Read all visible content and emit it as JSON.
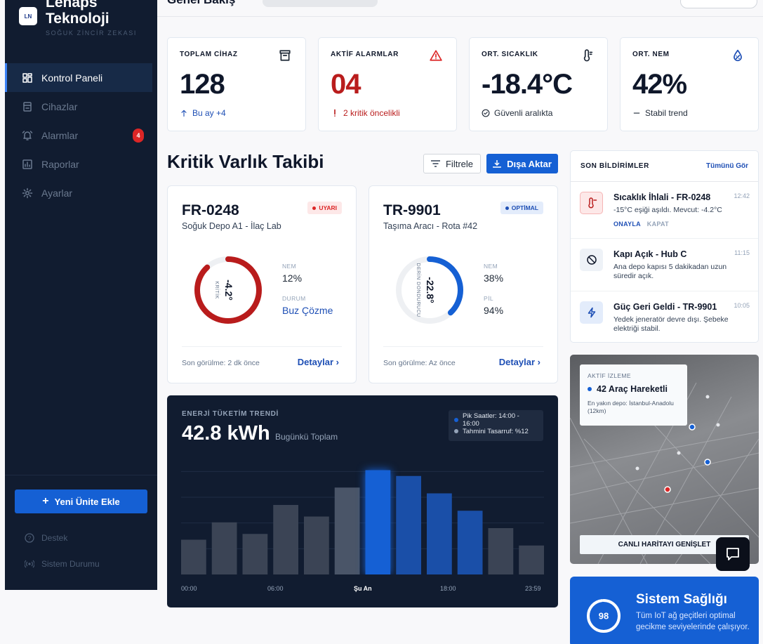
{
  "brand": {
    "name_line1": "Lenaps",
    "name_line2": "Teknoloji",
    "tagline": "SOĞUK ZİNCİR ZEKASI",
    "logo_text": "LN"
  },
  "nav": [
    {
      "label": "Kontrol Paneli",
      "icon": "dashboard-icon",
      "active": true
    },
    {
      "label": "Cihazlar",
      "icon": "devices-icon"
    },
    {
      "label": "Alarmlar",
      "icon": "alarm-icon",
      "badge": "4"
    },
    {
      "label": "Raporlar",
      "icon": "reports-icon"
    },
    {
      "label": "Ayarlar",
      "icon": "settings-icon"
    }
  ],
  "sidebar_actions": {
    "add_unit": "Yeni Ünite Ekle",
    "support": "Destek",
    "system_status": "Sistem Durumu"
  },
  "header": {
    "title": "Genel Bakış"
  },
  "stats": [
    {
      "label": "TOPLAM CİHAZ",
      "value": "128",
      "sub": "Bu ay +4",
      "sub_icon": "arrow-up-icon",
      "icon": "archive-icon",
      "value_color": "#0f172a",
      "sub_color": "#1e4fb5"
    },
    {
      "label": "AKTİF ALARMLAR",
      "value": "04",
      "sub": "2 kritik öncelikli",
      "sub_icon": "exclamation-icon",
      "icon": "warning-icon",
      "value_color": "#b91c1c",
      "sub_color": "#b91c1c"
    },
    {
      "label": "ORT. SICAKLIK",
      "value": "-18.4°C",
      "sub": "Güvenli aralıkta",
      "sub_icon": "check-circle-icon",
      "icon": "thermometer-icon",
      "value_color": "#0f172a",
      "sub_color": "#1f2937"
    },
    {
      "label": "ORT. NEM",
      "value": "42%",
      "sub": "Stabil trend",
      "sub_icon": "dash-icon",
      "icon": "humidity-icon",
      "value_color": "#0f172a",
      "sub_color": "#1f2937"
    }
  ],
  "section": {
    "title": "Kritik Varlık Takibi",
    "filter": "Filtrele",
    "export": "Dışa Aktar"
  },
  "assets": [
    {
      "id": "FR-0248",
      "location": "Soğuk Depo A1 - İlaç Lab",
      "tag": "UYARI",
      "tag_color": "#dc2626",
      "tag_bg": "#fde8e8",
      "gauge_value": "-4.2°",
      "gauge_label": "KRİTİK",
      "gauge_fill": 0.88,
      "gauge_color": "#b91c1c",
      "m1_label": "NEM",
      "m1_value": "12%",
      "m2_label": "DURUM",
      "m2_value": "Buz Çözme",
      "m2_color": "#1e4fb5",
      "last_seen": "Son görülme: 2 dk önce",
      "details": "Detaylar"
    },
    {
      "id": "TR-9901",
      "location": "Taşıma Aracı - Rota #42",
      "tag": "OPTİMAL",
      "tag_color": "#1e4fb5",
      "tag_bg": "#e3ecfb",
      "gauge_value": "-22.8°",
      "gauge_label": "DERİN DONDURUCU",
      "gauge_fill": 0.38,
      "gauge_color": "#1560d4",
      "m1_label": "NEM",
      "m1_value": "38%",
      "m2_label": "PİL",
      "m2_value": "94%",
      "m2_color": "#1f2937",
      "last_seen": "Son görülme: Az önce",
      "details": "Detaylar"
    }
  ],
  "energy": {
    "label": "ENERJİ TÜKETİM TRENDİ",
    "value": "42.8 kWh",
    "unit_label": "Bugünkü Toplam",
    "legend": [
      "Pik Saatler: 14:00 - 16:00",
      "Tahmini Tasarruf: %12"
    ],
    "colors": {
      "peak": "#1560d4",
      "saving": "#94a3b8"
    }
  },
  "chart_data": {
    "type": "bar",
    "title": "ENERJİ TÜKETİM TRENDİ",
    "x_tick_labels": [
      "00:00",
      "06:00",
      "Şu An",
      "18:00",
      "23:59"
    ],
    "values": [
      0.3,
      0.45,
      0.35,
      0.6,
      0.5,
      0.75,
      0.9,
      0.85,
      0.7,
      0.55,
      0.4,
      0.25
    ],
    "series_kind": [
      "past",
      "past",
      "past",
      "past",
      "past",
      "past-light",
      "current",
      "peak",
      "peak",
      "peak",
      "past",
      "past"
    ],
    "ylim": [
      0,
      1
    ],
    "grid": true
  },
  "notifications": {
    "title": "SON BİLDİRİMLER",
    "see_all": "Tümünü Gör",
    "items": [
      {
        "title": "Sıcaklık İhlali - FR-0248",
        "time": "12:42",
        "desc": "-15°C eşiği aşıldı. Mevcut: -4.2°C",
        "icon": "thermometer-alert-icon",
        "icon_bg": "#fde8e8",
        "icon_color": "#b91c1c",
        "action1": "ONAYLA",
        "action2": "KAPAT"
      },
      {
        "title": "Kapı Açık - Hub C",
        "time": "11:15",
        "desc": "Ana depo kapısı 5 dakikadan uzun süredir açık.",
        "icon": "door-blocked-icon",
        "icon_bg": "#eef2f7",
        "icon_color": "#0f172a"
      },
      {
        "title": "Güç Geri Geldi - TR-9901",
        "time": "10:05",
        "desc": "Yedek jeneratör devre dışı. Şebeke elektriği stabil.",
        "icon": "bolt-icon",
        "icon_bg": "#e3ecfb",
        "icon_color": "#1e4fb5"
      }
    ]
  },
  "map": {
    "label": "AKTİF İZLEME",
    "value": "42 Araç Hareketli",
    "desc": "En yakın depo: İstanbul-Anadolu (12km)",
    "button": "CANLI HARİTAYI GENİŞLET"
  },
  "health": {
    "score": "98",
    "score_fill": 0.98,
    "title": "Sistem Sağlığı",
    "desc": "Tüm IoT ağ geçitleri optimal gecikme seviyelerinde çalışıyor."
  }
}
